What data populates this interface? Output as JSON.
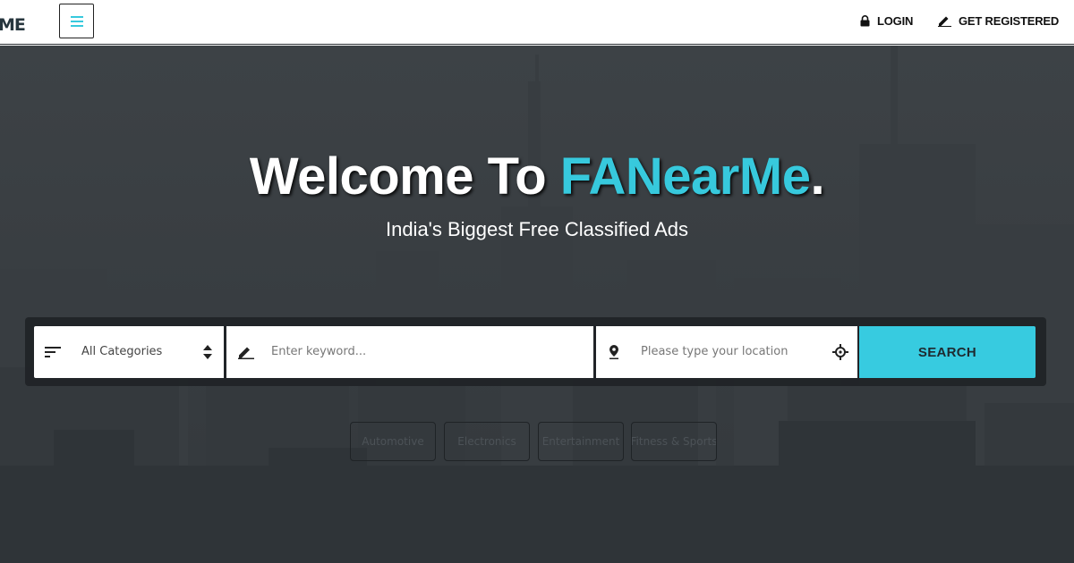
{
  "header": {
    "logo_text": "ME",
    "menu_icon": "hamburger-icon",
    "login_label": "LOGIN",
    "login_icon": "lock-icon",
    "register_label": "GET REGISTERED",
    "register_icon": "pencil-icon"
  },
  "hero": {
    "title_prefix": "Welcome To ",
    "title_brand": "FANearMe",
    "title_suffix": ".",
    "subtitle": "India's Biggest Free Classified Ads",
    "brand_color": "#37c9dd"
  },
  "search": {
    "category_value": "All Categories",
    "category_icon": "sort-icon",
    "keyword_placeholder": "Enter keyword...",
    "keyword_icon": "pencil-icon",
    "location_placeholder": "Please type your location",
    "location_icon": "map-pin-icon",
    "locate_icon": "crosshair-icon",
    "button_label": "SEARCH",
    "button_color": "#37cbe0"
  },
  "tags": [
    {
      "label": "Automotive"
    },
    {
      "label": "Electronics"
    },
    {
      "label": "Entertainment"
    },
    {
      "label": "Fitness & Sports"
    }
  ]
}
